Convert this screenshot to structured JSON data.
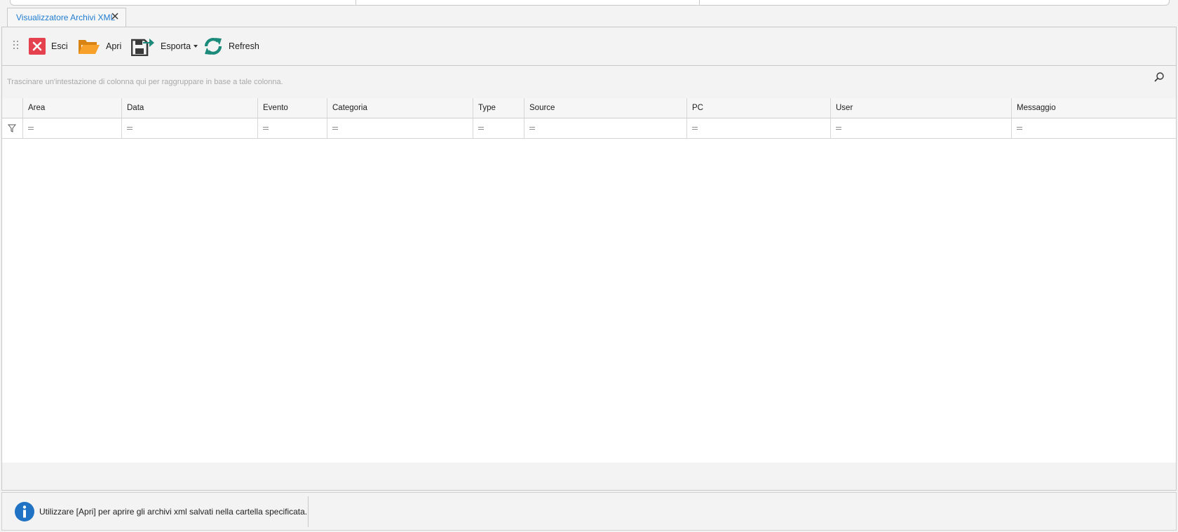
{
  "document_tab": {
    "title": "Visualizzatore Archivi XML"
  },
  "toolbar": {
    "exit_label": "Esci",
    "open_label": "Apri",
    "export_label": "Esporta",
    "refresh_label": "Refresh"
  },
  "grid": {
    "group_panel_hint": "Trascinare un'intestazione di colonna qui per raggruppare in base a tale colonna.",
    "columns": [
      {
        "label": "Area"
      },
      {
        "label": "Data"
      },
      {
        "label": "Evento"
      },
      {
        "label": "Categoria"
      },
      {
        "label": "Type"
      },
      {
        "label": "Source"
      },
      {
        "label": "PC"
      },
      {
        "label": "User"
      },
      {
        "label": "Messaggio"
      }
    ],
    "rows": []
  },
  "status": {
    "message": "Utilizzare [Apri] per aprire gli archivi xml salvati nella cartella specificata."
  },
  "colors": {
    "accent": "#1f7bd0",
    "exit_red": "#e5404e",
    "folder_orange": "#f7a02a",
    "refresh_teal": "#1b8a7a",
    "info_blue": "#1f72c4"
  },
  "icons": [
    "close-icon",
    "grip-icon",
    "exit-icon",
    "folder-open-icon",
    "save-export-icon",
    "chevron-down-icon",
    "refresh-icon",
    "search-icon",
    "filter-icon",
    "info-icon"
  ]
}
